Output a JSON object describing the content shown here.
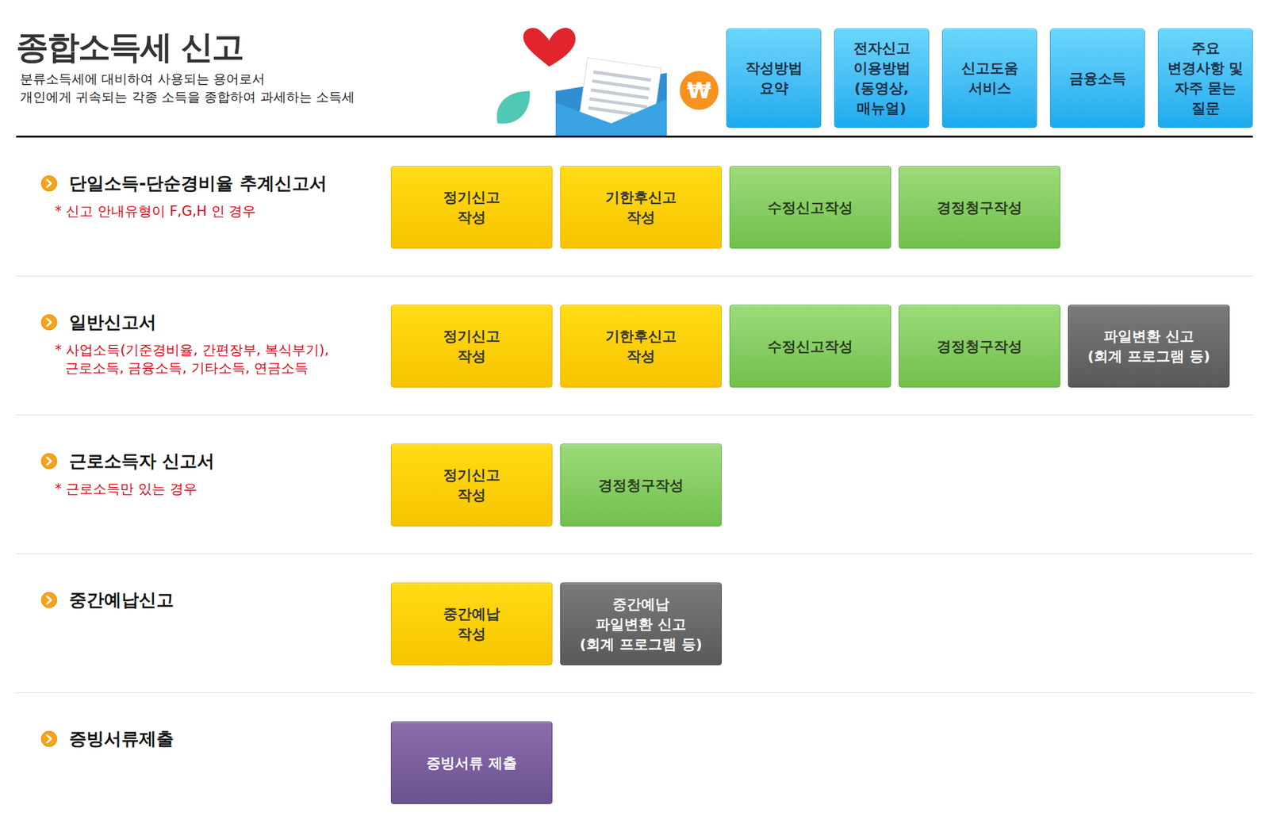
{
  "header": {
    "title": "종합소득세 신고",
    "description": [
      "분류소득세에 대비하여 사용되는 용어로서",
      "개인에게 귀속되는 각종 소득을 종합하여 과세하는 소득세"
    ],
    "currency_symbol": "₩",
    "links": [
      {
        "label": [
          "작성방법",
          "요약"
        ]
      },
      {
        "label": [
          "전자신고",
          "이용방법",
          "(동영상,",
          "매뉴얼)"
        ]
      },
      {
        "label": [
          "신고도움",
          "서비스"
        ]
      },
      {
        "label": [
          "금융소득"
        ]
      },
      {
        "label": [
          "주요",
          "변경사항 및",
          "자주 묻는",
          "질문"
        ]
      }
    ]
  },
  "sections": [
    {
      "title": "단일소득-단순경비율 추계신고서",
      "notes": [
        "* 신고 안내유형이 F,G,H 인 경우"
      ],
      "buttons": [
        {
          "label": [
            "정기신고",
            "작성"
          ],
          "kind": "yellow"
        },
        {
          "label": [
            "기한후신고",
            "작성"
          ],
          "kind": "yellow"
        },
        {
          "label": [
            "수정신고작성"
          ],
          "kind": "green"
        },
        {
          "label": [
            "경정청구작성"
          ],
          "kind": "green"
        }
      ]
    },
    {
      "title": "일반신고서",
      "notes": [
        "* 사업소득(기준경비율, 간편장부, 복식부기),",
        "근로소득, 금융소득, 기타소득, 연금소득"
      ],
      "buttons": [
        {
          "label": [
            "정기신고",
            "작성"
          ],
          "kind": "yellow"
        },
        {
          "label": [
            "기한후신고",
            "작성"
          ],
          "kind": "yellow"
        },
        {
          "label": [
            "수정신고작성"
          ],
          "kind": "green"
        },
        {
          "label": [
            "경정청구작성"
          ],
          "kind": "green"
        },
        {
          "label": [
            "파일변환 신고",
            "(회계 프로그램 등)"
          ],
          "kind": "gray"
        }
      ]
    },
    {
      "title": "근로소득자 신고서",
      "notes": [
        "* 근로소득만 있는 경우"
      ],
      "buttons": [
        {
          "label": [
            "정기신고",
            "작성"
          ],
          "kind": "yellow"
        },
        {
          "label": [
            "경정청구작성"
          ],
          "kind": "green"
        }
      ]
    },
    {
      "title": "중간예납신고",
      "notes": [],
      "buttons": [
        {
          "label": [
            "중간예납",
            "작성"
          ],
          "kind": "yellow"
        },
        {
          "label": [
            "중간예납",
            "파일변환 신고",
            "(회계 프로그램 등)"
          ],
          "kind": "gray"
        }
      ]
    },
    {
      "title": "증빙서류제출",
      "notes": [],
      "buttons": [
        {
          "label": [
            "증빙서류 제출"
          ],
          "kind": "purple"
        }
      ]
    }
  ]
}
